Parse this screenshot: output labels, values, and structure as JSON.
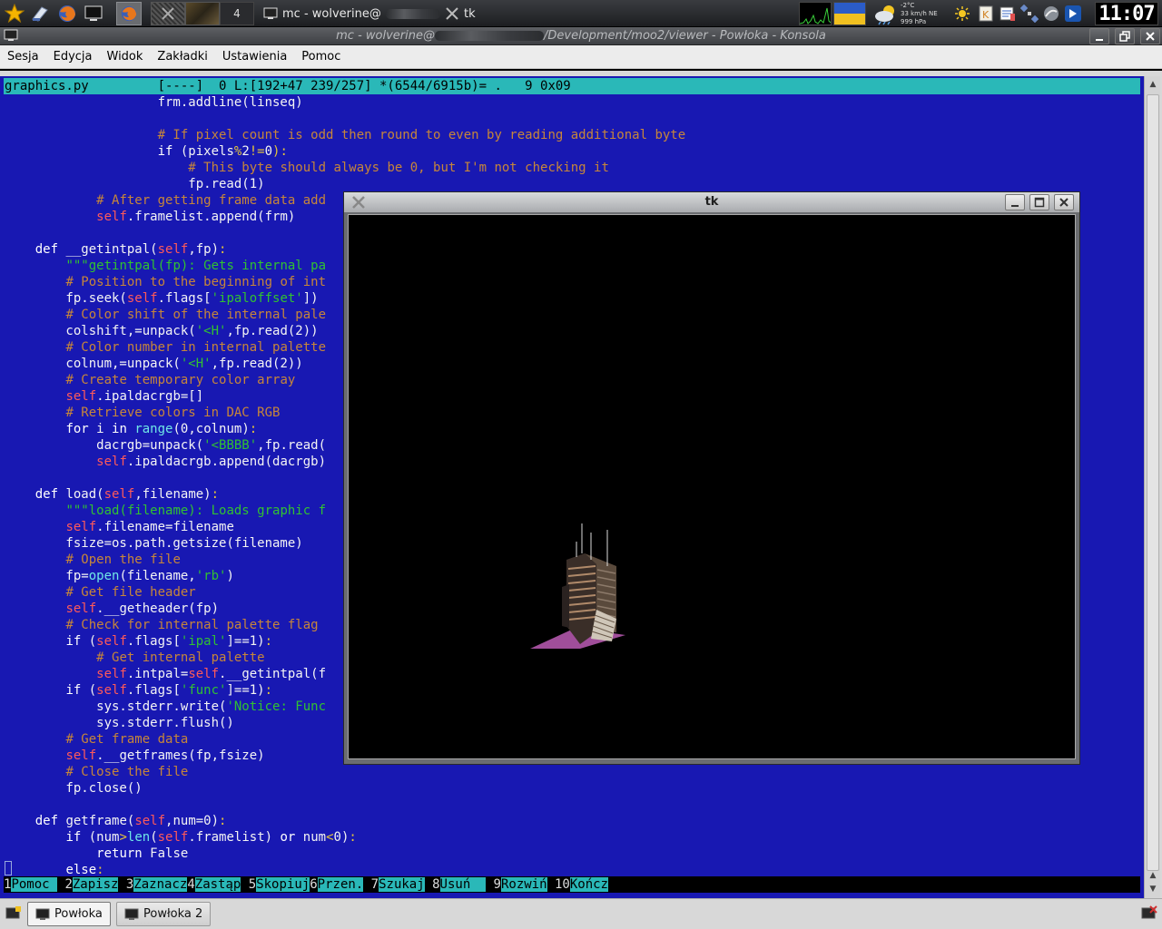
{
  "top_panel": {
    "pager_number": "4",
    "task_konsole": "mc - wolverine@",
    "task_tk": "tk",
    "weather": {
      "temp": "-2°C",
      "wind": "33 km/h NE",
      "pressure": "999 hPa"
    },
    "clock": "11:07"
  },
  "konsole": {
    "title_left": "mc - wolverine@",
    "title_right": "/Development/moo2/viewer - Powłoka - Konsola",
    "menu": [
      "Sesja",
      "Edycja",
      "Widok",
      "Zakładki",
      "Ustawienia",
      "Pomoc"
    ]
  },
  "editor": {
    "header": "graphics.py         [----]  0 L:[192+47 239/257] *(6544/6915b)= .   9 0x09",
    "lines": [
      [
        [
          "t",
          "                    frm.addline(linseq)"
        ]
      ],
      [
        [
          "t",
          ""
        ]
      ],
      [
        [
          "t",
          "                    "
        ],
        [
          "cm",
          "# If pixel count is odd then round to even by reading additional byte"
        ]
      ],
      [
        [
          "t",
          "                    "
        ],
        [
          "kw",
          "if"
        ],
        [
          "t",
          " (pixels"
        ],
        [
          "op",
          "%"
        ],
        [
          "t",
          "2"
        ],
        [
          "op",
          "!="
        ],
        [
          "t",
          "0"
        ],
        [
          "op",
          ")"
        ],
        [
          "op",
          ":"
        ]
      ],
      [
        [
          "t",
          "                        "
        ],
        [
          "cm",
          "# This byte should always be 0, but I'm not checking it"
        ]
      ],
      [
        [
          "t",
          "                        fp.read(1)"
        ]
      ],
      [
        [
          "t",
          "            "
        ],
        [
          "cm",
          "# After getting frame data add"
        ]
      ],
      [
        [
          "t",
          "            "
        ],
        [
          "sf",
          "self"
        ],
        [
          "t",
          ".framelist.append(frm)"
        ]
      ],
      [
        [
          "t",
          ""
        ]
      ],
      [
        [
          "t",
          "    "
        ],
        [
          "kw",
          "def"
        ],
        [
          "t",
          " __getintpal("
        ],
        [
          "sf",
          "self"
        ],
        [
          "t",
          ",fp)"
        ],
        [
          "op",
          ":"
        ]
      ],
      [
        [
          "t",
          "        "
        ],
        [
          "st",
          "\"\"\"getintpal(fp): Gets internal pa"
        ]
      ],
      [
        [
          "t",
          "        "
        ],
        [
          "cm",
          "# Position to the beginning of int"
        ]
      ],
      [
        [
          "t",
          "        fp.seek("
        ],
        [
          "sf",
          "self"
        ],
        [
          "t",
          ".flags["
        ],
        [
          "st",
          "'ipaloffset'"
        ],
        [
          "t",
          "])"
        ]
      ],
      [
        [
          "t",
          "        "
        ],
        [
          "cm",
          "# Color shift of the internal pale"
        ]
      ],
      [
        [
          "t",
          "        colshift,=unpack("
        ],
        [
          "st",
          "'<H'"
        ],
        [
          "t",
          ",fp.read(2))"
        ]
      ],
      [
        [
          "t",
          "        "
        ],
        [
          "cm",
          "# Color number in internal palette"
        ]
      ],
      [
        [
          "t",
          "        colnum,=unpack("
        ],
        [
          "st",
          "'<H'"
        ],
        [
          "t",
          ",fp.read(2))"
        ]
      ],
      [
        [
          "t",
          "        "
        ],
        [
          "cm",
          "# Create temporary color array"
        ]
      ],
      [
        [
          "t",
          "        "
        ],
        [
          "sf",
          "self"
        ],
        [
          "t",
          ".ipaldacrgb=[]"
        ]
      ],
      [
        [
          "t",
          "        "
        ],
        [
          "cm",
          "# Retrieve colors in DAC RGB"
        ]
      ],
      [
        [
          "t",
          "        "
        ],
        [
          "kw",
          "for"
        ],
        [
          "t",
          " i "
        ],
        [
          "kw",
          "in"
        ],
        [
          "t",
          " "
        ],
        [
          "fn",
          "range"
        ],
        [
          "t",
          "(0,colnum)"
        ],
        [
          "op",
          ":"
        ]
      ],
      [
        [
          "t",
          "            dacrgb=unpack("
        ],
        [
          "st",
          "'<BBBB'"
        ],
        [
          "t",
          ",fp.read("
        ]
      ],
      [
        [
          "t",
          "            "
        ],
        [
          "sf",
          "self"
        ],
        [
          "t",
          ".ipaldacrgb.append(dacrgb)"
        ]
      ],
      [
        [
          "t",
          ""
        ]
      ],
      [
        [
          "t",
          "    "
        ],
        [
          "kw",
          "def"
        ],
        [
          "t",
          " load("
        ],
        [
          "sf",
          "self"
        ],
        [
          "t",
          ",filename)"
        ],
        [
          "op",
          ":"
        ]
      ],
      [
        [
          "t",
          "        "
        ],
        [
          "st",
          "\"\"\"load(filename): Loads graphic f"
        ]
      ],
      [
        [
          "t",
          "        "
        ],
        [
          "sf",
          "self"
        ],
        [
          "t",
          ".filename=filename"
        ]
      ],
      [
        [
          "t",
          "        fsize=os.path.getsize(filename)"
        ]
      ],
      [
        [
          "t",
          "        "
        ],
        [
          "cm",
          "# Open the file"
        ]
      ],
      [
        [
          "t",
          "        fp="
        ],
        [
          "fn",
          "open"
        ],
        [
          "t",
          "(filename,"
        ],
        [
          "st",
          "'rb'"
        ],
        [
          "t",
          ")"
        ]
      ],
      [
        [
          "t",
          "        "
        ],
        [
          "cm",
          "# Get file header"
        ]
      ],
      [
        [
          "t",
          "        "
        ],
        [
          "sf",
          "self"
        ],
        [
          "t",
          ".__getheader(fp)"
        ]
      ],
      [
        [
          "t",
          "        "
        ],
        [
          "cm",
          "# Check for internal palette flag"
        ]
      ],
      [
        [
          "t",
          "        "
        ],
        [
          "kw",
          "if"
        ],
        [
          "t",
          " ("
        ],
        [
          "sf",
          "self"
        ],
        [
          "t",
          ".flags["
        ],
        [
          "st",
          "'ipal'"
        ],
        [
          "t",
          "]==1)"
        ],
        [
          "op",
          ":"
        ]
      ],
      [
        [
          "t",
          "            "
        ],
        [
          "cm",
          "# Get internal palette"
        ]
      ],
      [
        [
          "t",
          "            "
        ],
        [
          "sf",
          "self"
        ],
        [
          "t",
          ".intpal="
        ],
        [
          "sf",
          "self"
        ],
        [
          "t",
          ".__getintpal(f"
        ]
      ],
      [
        [
          "t",
          "        "
        ],
        [
          "kw",
          "if"
        ],
        [
          "t",
          " ("
        ],
        [
          "sf",
          "self"
        ],
        [
          "t",
          ".flags["
        ],
        [
          "st",
          "'func'"
        ],
        [
          "t",
          "]==1)"
        ],
        [
          "op",
          ":"
        ]
      ],
      [
        [
          "t",
          "            sys.stderr.write("
        ],
        [
          "st",
          "'Notice: Func"
        ]
      ],
      [
        [
          "t",
          "            sys.stderr.flush()"
        ]
      ],
      [
        [
          "t",
          "        "
        ],
        [
          "cm",
          "# Get frame data"
        ]
      ],
      [
        [
          "t",
          "        "
        ],
        [
          "sf",
          "self"
        ],
        [
          "t",
          ".__getframes(fp,fsize)"
        ]
      ],
      [
        [
          "t",
          "        "
        ],
        [
          "cm",
          "# Close the file"
        ]
      ],
      [
        [
          "t",
          "        fp.close()"
        ]
      ],
      [
        [
          "t",
          ""
        ]
      ],
      [
        [
          "t",
          "    "
        ],
        [
          "kw",
          "def"
        ],
        [
          "t",
          " getframe("
        ],
        [
          "sf",
          "self"
        ],
        [
          "t",
          ",num=0)"
        ],
        [
          "op",
          ":"
        ]
      ],
      [
        [
          "t",
          "        "
        ],
        [
          "kw",
          "if"
        ],
        [
          "t",
          " (num"
        ],
        [
          "op",
          ">"
        ],
        [
          "fn",
          "len"
        ],
        [
          "t",
          "("
        ],
        [
          "sf",
          "self"
        ],
        [
          "t",
          ".framelist) "
        ],
        [
          "kw",
          "or"
        ],
        [
          "t",
          " num"
        ],
        [
          "op",
          "<"
        ],
        [
          "t",
          "0)"
        ],
        [
          "op",
          ":"
        ]
      ],
      [
        [
          "t",
          "            "
        ],
        [
          "kw",
          "return"
        ],
        [
          "t",
          " False"
        ]
      ],
      [
        [
          "t",
          "        "
        ],
        [
          "kw",
          "else"
        ],
        [
          "op",
          ":"
        ]
      ]
    ],
    "fkeys": [
      {
        "num": "1",
        "label": "Pomoc "
      },
      {
        "num": " 2",
        "label": "Zapisz"
      },
      {
        "num": " 3",
        "label": "Zaznacz"
      },
      {
        "num": "4",
        "label": "Zastąp"
      },
      {
        "num": " 5",
        "label": "Skopiuj"
      },
      {
        "num": "6",
        "label": "Przen."
      },
      {
        "num": " 7",
        "label": "Szukaj"
      },
      {
        "num": " 8",
        "label": "Usuń  "
      },
      {
        "num": " 9",
        "label": "Rozwiń"
      },
      {
        "num": " 10",
        "label": "Kończ"
      }
    ]
  },
  "tk_window": {
    "title": "tk"
  },
  "bottom_bar": {
    "tabs": [
      "Powłoka",
      "Powłoka 2"
    ]
  }
}
